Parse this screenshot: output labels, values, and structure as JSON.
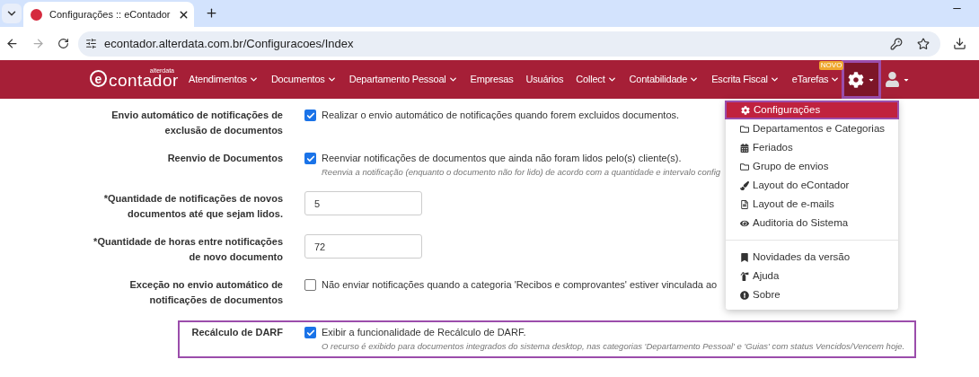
{
  "browser": {
    "tab_title": "Configurações :: eContador",
    "url": "econtador.alterdata.com.br/Configuracoes/Index"
  },
  "logo": {
    "mark": "e",
    "name": "contador",
    "brand": "alterdata"
  },
  "nav": [
    {
      "label": "Atendimentos",
      "dropdown": true
    },
    {
      "label": "Documentos",
      "dropdown": true
    },
    {
      "label": "Departamento Pessoal",
      "dropdown": true
    },
    {
      "label": "Empresas",
      "dropdown": false
    },
    {
      "label": "Usuários",
      "dropdown": false
    },
    {
      "label": "Collect",
      "dropdown": true
    },
    {
      "label": "Contabilidade",
      "dropdown": true
    },
    {
      "label": "Escrita Fiscal",
      "dropdown": true
    },
    {
      "label": "eTarefas",
      "dropdown": true,
      "badge": "NOVO"
    }
  ],
  "settings_button": {
    "highlighted": true,
    "expanded": true
  },
  "settings": [
    {
      "kind": "checkbox",
      "label": "Envio automático de notificações de exclusão de documentos",
      "checked": true,
      "text": "Realizar o envio automático de notificações quando forem excluidos documentos.",
      "highlighted": false
    },
    {
      "kind": "checkbox",
      "label": "Reenvio de Documentos",
      "checked": true,
      "text": "Reenviar notificações de documentos que ainda não foram lidos pelo(s) cliente(s).",
      "hint": "Reenvia a notificação (enquanto o documento não for lido) de acordo com a quantidade e intervalo config",
      "highlighted": false
    },
    {
      "kind": "input",
      "label": "*Quantidade de notificações de novos documentos até que sejam lidos.",
      "value": "5",
      "highlighted": false
    },
    {
      "kind": "input",
      "label": "*Quantidade de horas entre notificações de novo documento",
      "value": "72",
      "highlighted": false
    },
    {
      "kind": "checkbox",
      "label": "Exceção no envio automático de notificações de documentos",
      "checked": false,
      "text": "Não enviar notificações quando a categoria 'Recibos e comprovantes' estiver vinculada ao",
      "highlighted": false
    },
    {
      "kind": "checkbox",
      "label": "Recálculo de DARF",
      "checked": true,
      "text": "Exibir a funcionalidade de Recálculo de DARF.",
      "hint": "O recurso é exibido para documentos integrados do sistema desktop, nas categorias 'Departamento Pessoal' e 'Guias' com status Vencidos/Vencem hoje.",
      "highlighted": true
    }
  ],
  "menu": [
    {
      "kind": "item",
      "label": "Configurações",
      "selected": true,
      "highlighted": true
    },
    {
      "kind": "item",
      "label": "Departamentos e Categorias",
      "selected": false,
      "highlighted": false
    },
    {
      "kind": "item",
      "label": "Feriados",
      "selected": false,
      "highlighted": false
    },
    {
      "kind": "item",
      "label": "Grupo de envios",
      "selected": false,
      "highlighted": false
    },
    {
      "kind": "item",
      "label": "Layout do eContador",
      "selected": false,
      "highlighted": false
    },
    {
      "kind": "item",
      "label": "Layout de e-mails",
      "selected": false,
      "highlighted": false
    },
    {
      "kind": "item",
      "label": "Auditoria do Sistema",
      "selected": false,
      "highlighted": false
    },
    {
      "kind": "divider"
    },
    {
      "kind": "item",
      "label": "Novidades da versão",
      "selected": false,
      "highlighted": false
    },
    {
      "kind": "item",
      "label": "Ajuda",
      "selected": false,
      "highlighted": false
    },
    {
      "kind": "item",
      "label": "Sobre",
      "selected": false,
      "highlighted": false
    }
  ]
}
